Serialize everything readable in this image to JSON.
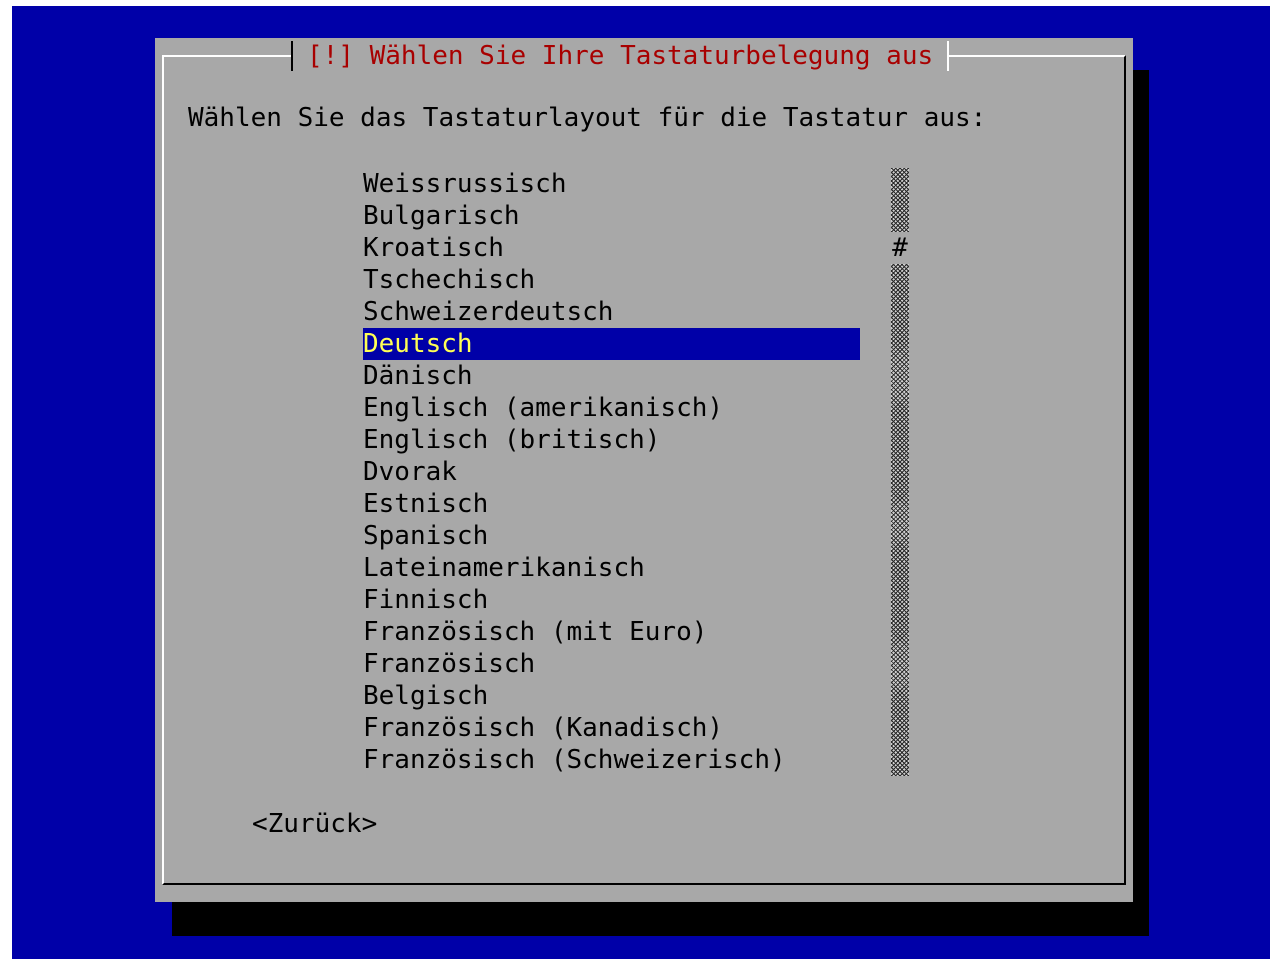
{
  "dialog": {
    "title": "[!] Wählen Sie Ihre Tastaturbelegung aus",
    "prompt": "Wählen Sie das Tastaturlayout für die Tastatur aus:",
    "scrollbar_thumb": "#",
    "back_button": "<Zurück>"
  },
  "keyboard_list": {
    "selected_index": 5,
    "items": [
      "Weissrussisch",
      "Bulgarisch",
      "Kroatisch",
      "Tschechisch",
      "Schweizerdeutsch",
      "Deutsch",
      "Dänisch",
      "Englisch (amerikanisch)",
      "Englisch (britisch)",
      "Dvorak",
      "Estnisch",
      "Spanisch",
      "Lateinamerikanisch",
      "Finnisch",
      "Französisch (mit Euro)",
      "Französisch",
      "Belgisch",
      "Französisch (Kanadisch)",
      "Französisch (Schweizerisch)"
    ]
  },
  "colors": {
    "background": "#0000a8",
    "dialog": "#a8a8a8",
    "title": "#a80000",
    "selection_bg": "#0000a8",
    "selection_fg": "#ffff54"
  }
}
